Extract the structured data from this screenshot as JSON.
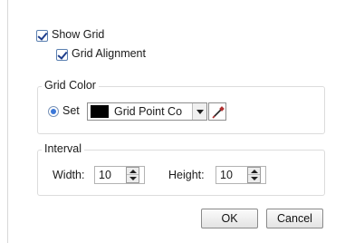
{
  "show_grid": {
    "label": "Show Grid",
    "checked": true
  },
  "grid_alignment": {
    "label": "Grid Alignment",
    "checked": true
  },
  "grid_color": {
    "title": "Grid Color",
    "radio_label": "Set",
    "radio_selected": true,
    "selected_value": "Grid Point Co",
    "swatch_color": "#000000",
    "picker_icon": "eyedropper-icon"
  },
  "interval": {
    "title": "Interval",
    "width_label": "Width:",
    "width_value": "10",
    "height_label": "Height:",
    "height_value": "10"
  },
  "buttons": {
    "ok": "OK",
    "cancel": "Cancel"
  }
}
